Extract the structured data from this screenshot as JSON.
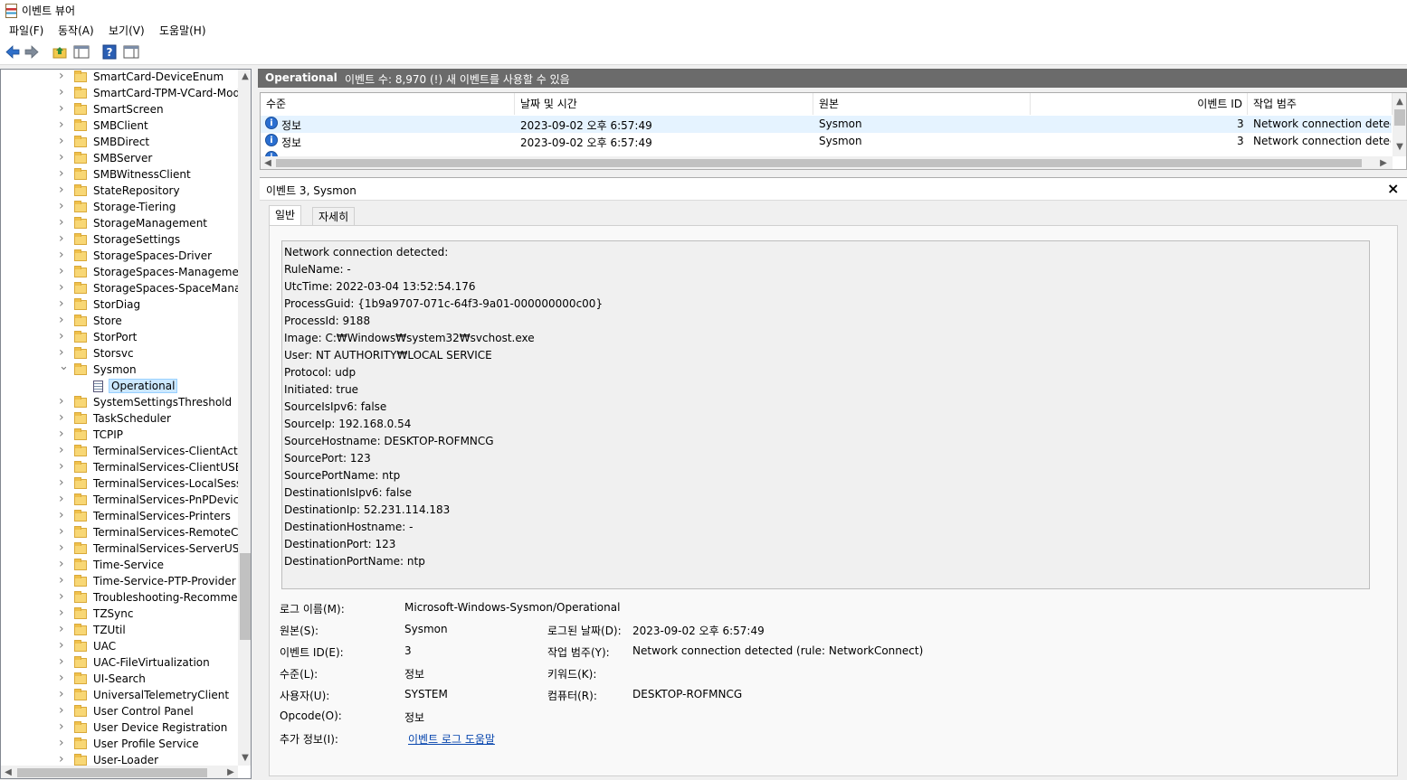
{
  "window": {
    "title": "이벤트 뷰어"
  },
  "menu": [
    "파일(F)",
    "동작(A)",
    "보기(V)",
    "도움말(H)"
  ],
  "toolbar": {
    "buttons": [
      {
        "name": "back-icon"
      },
      {
        "name": "forward-icon"
      },
      {
        "name": "up-folder-icon"
      },
      {
        "name": "show-hide-tree-icon"
      },
      {
        "name": "help-icon"
      },
      {
        "name": "show-hide-action-pane-icon"
      }
    ]
  },
  "tree": {
    "items": [
      {
        "label": "SmartCard-DeviceEnum",
        "expanded": false
      },
      {
        "label": "SmartCard-TPM-VCard-Modu",
        "expanded": false
      },
      {
        "label": "SmartScreen",
        "expanded": false
      },
      {
        "label": "SMBClient",
        "expanded": false
      },
      {
        "label": "SMBDirect",
        "expanded": false
      },
      {
        "label": "SMBServer",
        "expanded": false
      },
      {
        "label": "SMBWitnessClient",
        "expanded": false
      },
      {
        "label": "StateRepository",
        "expanded": false
      },
      {
        "label": "Storage-Tiering",
        "expanded": false
      },
      {
        "label": "StorageManagement",
        "expanded": false
      },
      {
        "label": "StorageSettings",
        "expanded": false
      },
      {
        "label": "StorageSpaces-Driver",
        "expanded": false
      },
      {
        "label": "StorageSpaces-ManagementA",
        "expanded": false
      },
      {
        "label": "StorageSpaces-SpaceManager",
        "expanded": false
      },
      {
        "label": "StorDiag",
        "expanded": false
      },
      {
        "label": "Store",
        "expanded": false
      },
      {
        "label": "StorPort",
        "expanded": false
      },
      {
        "label": "Storsvc",
        "expanded": false
      },
      {
        "label": "Sysmon",
        "expanded": true
      },
      {
        "label": "Operational",
        "selected": true,
        "child": true
      },
      {
        "label": "SystemSettingsThreshold",
        "expanded": false
      },
      {
        "label": "TaskScheduler",
        "expanded": false
      },
      {
        "label": "TCPIP",
        "expanded": false
      },
      {
        "label": "TerminalServices-ClientActiveX",
        "expanded": false
      },
      {
        "label": "TerminalServices-ClientUSBDe",
        "expanded": false
      },
      {
        "label": "TerminalServices-LocalSession",
        "expanded": false
      },
      {
        "label": "TerminalServices-PnPDevices",
        "expanded": false
      },
      {
        "label": "TerminalServices-Printers",
        "expanded": false
      },
      {
        "label": "TerminalServices-RemoteConn",
        "expanded": false
      },
      {
        "label": "TerminalServices-ServerUSBDe",
        "expanded": false
      },
      {
        "label": "Time-Service",
        "expanded": false
      },
      {
        "label": "Time-Service-PTP-Provider",
        "expanded": false
      },
      {
        "label": "Troubleshooting-Recommend",
        "expanded": false
      },
      {
        "label": "TZSync",
        "expanded": false
      },
      {
        "label": "TZUtil",
        "expanded": false
      },
      {
        "label": "UAC",
        "expanded": false
      },
      {
        "label": "UAC-FileVirtualization",
        "expanded": false
      },
      {
        "label": "UI-Search",
        "expanded": false
      },
      {
        "label": "UniversalTelemetryClient",
        "expanded": false
      },
      {
        "label": "User Control Panel",
        "expanded": false
      },
      {
        "label": "User Device Registration",
        "expanded": false
      },
      {
        "label": "User Profile Service",
        "expanded": false
      },
      {
        "label": "User-Loader",
        "expanded": false
      }
    ]
  },
  "header": {
    "log_name": "Operational",
    "event_count": "이벤트 수: 8,970 (!) 새 이벤트를 사용할 수 있음"
  },
  "event_list": {
    "columns": [
      "수준",
      "날짜 및 시간",
      "원본",
      "이벤트 ID",
      "작업 범주"
    ],
    "rows": [
      {
        "level": "정보",
        "datetime": "2023-09-02 오후 6:57:49",
        "source": "Sysmon",
        "id": "3",
        "category": "Network connection detected"
      },
      {
        "level": "정보",
        "datetime": "2023-09-02 오후 6:57:49",
        "source": "Sysmon",
        "id": "3",
        "category": "Network connection detected"
      }
    ]
  },
  "detail": {
    "title": "이벤트 3, Sysmon",
    "tabs": [
      "일반",
      "자세히"
    ],
    "message_lines": [
      "Network connection detected:",
      "RuleName: -",
      "UtcTime: 2022-03-04 13:52:54.176",
      "ProcessGuid: {1b9a9707-071c-64f3-9a01-000000000c00}",
      "ProcessId: 9188",
      "Image: C:₩Windows₩system32₩svchost.exe",
      "User: NT AUTHORITY₩LOCAL SERVICE",
      "Protocol: udp",
      "Initiated: true",
      "SourceIsIpv6: false",
      "SourceIp: 192.168.0.54",
      "SourceHostname: DESKTOP-ROFMNCG",
      "SourcePort: 123",
      "SourcePortName: ntp",
      "DestinationIsIpv6: false",
      "DestinationIp: 52.231.114.183",
      "DestinationHostname: -",
      "DestinationPort: 123",
      "DestinationPortName: ntp"
    ],
    "props": {
      "log_name_label": "로그 이름(M):",
      "log_name": "Microsoft-Windows-Sysmon/Operational",
      "source_label": "원본(S):",
      "source": "Sysmon",
      "logged_label": "로그된 날짜(D):",
      "logged": "2023-09-02 오후 6:57:49",
      "event_id_label": "이벤트 ID(E):",
      "event_id": "3",
      "task_label": "작업 범주(Y):",
      "task": "Network connection detected (rule: NetworkConnect)",
      "level_label": "수준(L):",
      "level": "정보",
      "keywords_label": "키워드(K):",
      "keywords": "",
      "user_label": "사용자(U):",
      "user": "SYSTEM",
      "computer_label": "컴퓨터(R):",
      "computer": "DESKTOP-ROFMNCG",
      "opcode_label": "Opcode(O):",
      "opcode": "정보",
      "more_info_label": "추가 정보(I):",
      "more_info_link": "이벤트 로그 도움말"
    }
  },
  "colors": {
    "header_band": "#6b6b6b",
    "selection": "#cce8ff",
    "info_icon": "#2a6fd1",
    "link": "#0645ad"
  }
}
